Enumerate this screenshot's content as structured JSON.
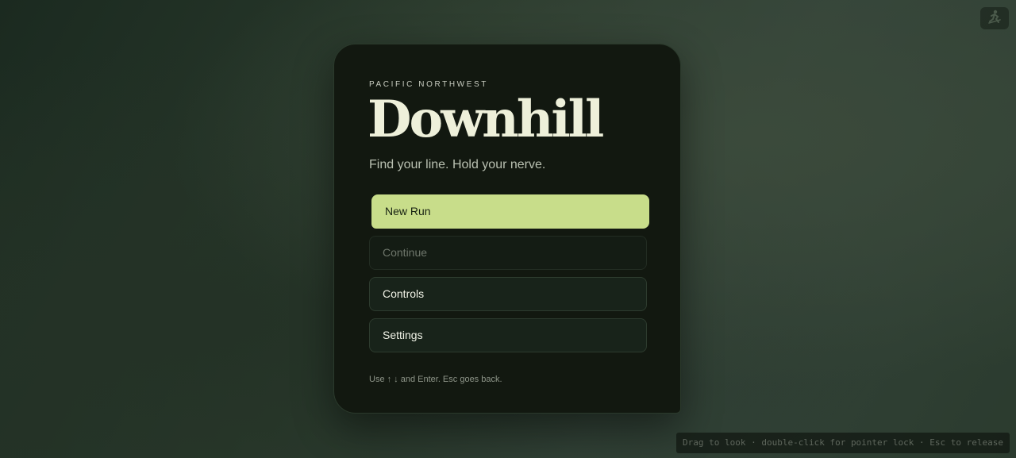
{
  "corner": {
    "icon": "figure-icon"
  },
  "menu": {
    "eyebrow": "PACIFIC NORTHWEST",
    "title": "Downhill",
    "tagline": "Find your line. Hold your nerve.",
    "items": [
      {
        "label": "New Run",
        "state": "selected"
      },
      {
        "label": "Continue",
        "state": "disabled"
      },
      {
        "label": "Controls",
        "state": "enabled"
      },
      {
        "label": "Settings",
        "state": "enabled"
      }
    ],
    "hint": "Use ↑ ↓ and Enter. Esc goes back."
  },
  "status": {
    "text": "Drag to look · double-click for pointer lock · Esc to release"
  },
  "colors": {
    "accent": "#c8dd8a",
    "card_background": "#121810",
    "title": "#eef0da"
  }
}
